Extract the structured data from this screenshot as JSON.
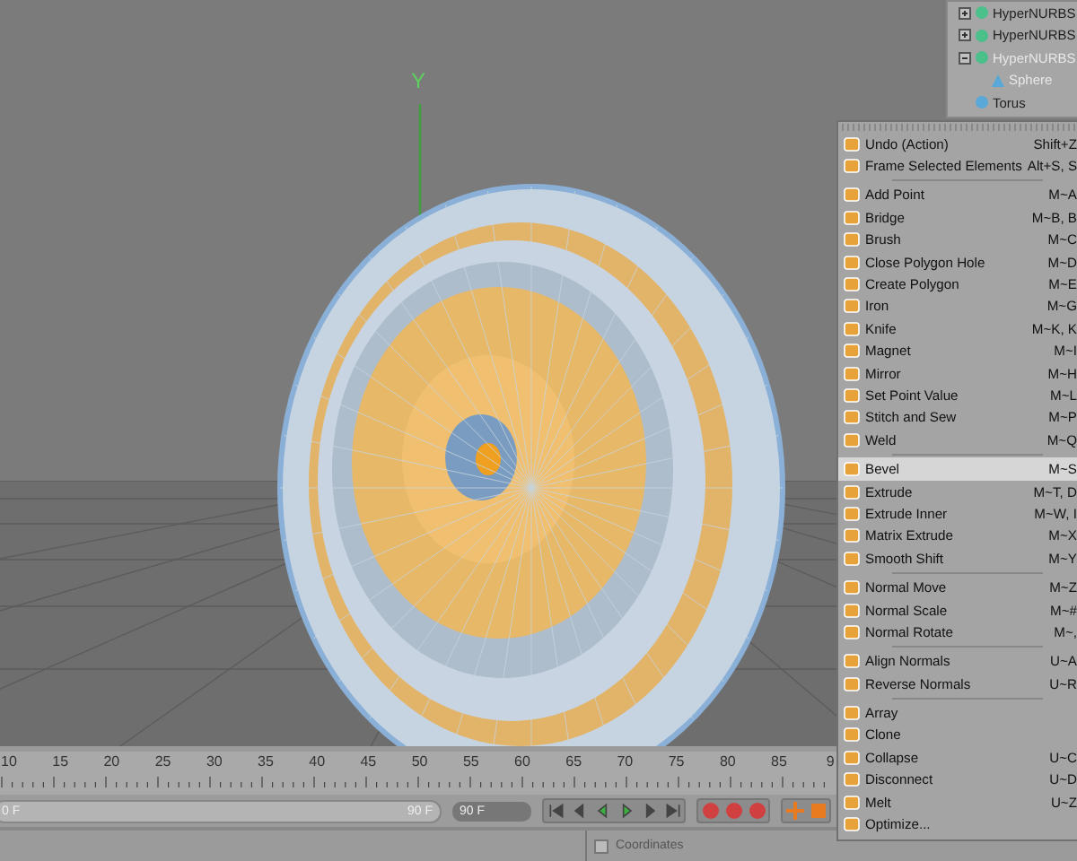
{
  "objects": [
    {
      "name": "HyperNURBS",
      "selected": false,
      "expanded": false
    },
    {
      "name": "HyperNURBS",
      "selected": false,
      "expanded": false
    },
    {
      "name": "HyperNURBS",
      "selected": true,
      "expanded": true,
      "children": [
        {
          "name": "Sphere",
          "selected": false
        }
      ]
    },
    {
      "name": "Torus",
      "selected": false
    }
  ],
  "menu": {
    "groups": [
      [
        {
          "label": "Undo (Action)",
          "shortcut": "Shift+Z",
          "selected": false
        },
        {
          "label": "Frame Selected Elements",
          "shortcut": "Alt+S, S",
          "selected": false
        }
      ],
      [
        {
          "label": "Add Point",
          "shortcut": "M~A",
          "selected": false
        },
        {
          "label": "Bridge",
          "shortcut": "M~B, B",
          "selected": false
        },
        {
          "label": "Brush",
          "shortcut": "M~C",
          "selected": false
        },
        {
          "label": "Close Polygon Hole",
          "shortcut": "M~D",
          "selected": false
        },
        {
          "label": "Create Polygon",
          "shortcut": "M~E",
          "selected": false
        },
        {
          "label": "Iron",
          "shortcut": "M~G",
          "selected": false
        },
        {
          "label": "Knife",
          "shortcut": "M~K, K",
          "selected": false
        },
        {
          "label": "Magnet",
          "shortcut": "M~I",
          "selected": false
        },
        {
          "label": "Mirror",
          "shortcut": "M~H",
          "selected": false
        },
        {
          "label": "Set Point Value",
          "shortcut": "M~L",
          "selected": false
        },
        {
          "label": "Stitch and Sew",
          "shortcut": "M~P",
          "selected": false
        },
        {
          "label": "Weld",
          "shortcut": "M~Q",
          "selected": false
        }
      ],
      [
        {
          "label": "Bevel",
          "shortcut": "M~S",
          "selected": true
        },
        {
          "label": "Extrude",
          "shortcut": "M~T, D",
          "selected": false
        },
        {
          "label": "Extrude Inner",
          "shortcut": "M~W, I",
          "selected": false
        },
        {
          "label": "Matrix Extrude",
          "shortcut": "M~X",
          "selected": false
        },
        {
          "label": "Smooth Shift",
          "shortcut": "M~Y",
          "selected": false
        }
      ],
      [
        {
          "label": "Normal Move",
          "shortcut": "M~Z",
          "selected": false
        },
        {
          "label": "Normal Scale",
          "shortcut": "M~#",
          "selected": false
        },
        {
          "label": "Normal Rotate",
          "shortcut": "M~,",
          "selected": false
        }
      ],
      [
        {
          "label": "Align Normals",
          "shortcut": "U~A",
          "selected": false
        },
        {
          "label": "Reverse Normals",
          "shortcut": "U~R",
          "selected": false
        }
      ],
      [
        {
          "label": "Array",
          "selected": false
        },
        {
          "label": "Clone",
          "selected": false
        },
        {
          "label": "Collapse",
          "shortcut": "U~C",
          "selected": false
        },
        {
          "label": "Disconnect",
          "shortcut": "U~D",
          "selected": false
        },
        {
          "label": "Melt",
          "shortcut": "U~Z",
          "selected": false
        },
        {
          "label": "Optimize...",
          "selected": false
        }
      ]
    ]
  },
  "timeline": {
    "ticks": [
      "10",
      "15",
      "20",
      "25",
      "30",
      "35",
      "40",
      "45",
      "50",
      "55",
      "60",
      "65",
      "70",
      "75",
      "80",
      "85",
      "9"
    ]
  },
  "axis_label": "Y",
  "range": {
    "start": "0 F",
    "end": "90 F",
    "level": 1
  },
  "frame_field": {
    "value": "90 F"
  },
  "coordinates": {
    "label": "Coordinates",
    "checked": false
  }
}
